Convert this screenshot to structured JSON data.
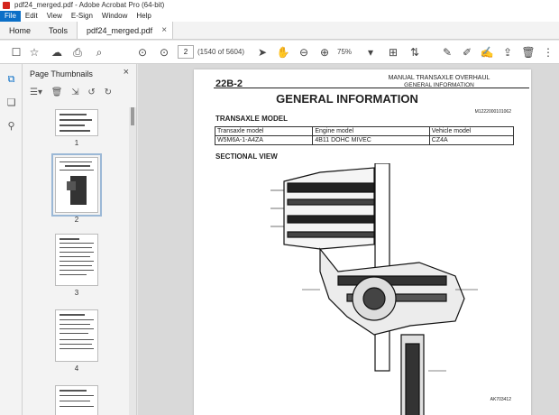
{
  "window": {
    "title": "pdf24_merged.pdf - Adobe Acrobat Pro (64-bit)"
  },
  "menu": [
    "File",
    "Edit",
    "View",
    "E-Sign",
    "Window",
    "Help"
  ],
  "tabs": {
    "home": "Home",
    "tools": "Tools",
    "document": "pdf24_merged.pdf"
  },
  "toolbar": {
    "page_current": "2",
    "page_count": "(1540 of 5604)",
    "zoom": "75%"
  },
  "thumbnails": {
    "title": "Page Thumbnails",
    "pages": [
      "1",
      "2",
      "3",
      "4"
    ]
  },
  "document": {
    "page_number": "22B-2",
    "header_title": "MANUAL TRANSAXLE OVERHAUL",
    "header_subtitle": "GENERAL INFORMATION",
    "main_title": "GENERAL INFORMATION",
    "doc_id": "M1222000101062",
    "section1": "TRANSAXLE MODEL",
    "table_header": [
      "Transaxle model",
      "Engine model",
      "Vehicle model"
    ],
    "table_row": [
      "W5M6A-1-A4ZA",
      "4B11 DOHC MIVEC",
      "CZ4A"
    ],
    "section2": "SECTIONAL VIEW",
    "figure_id": "AK703412"
  }
}
